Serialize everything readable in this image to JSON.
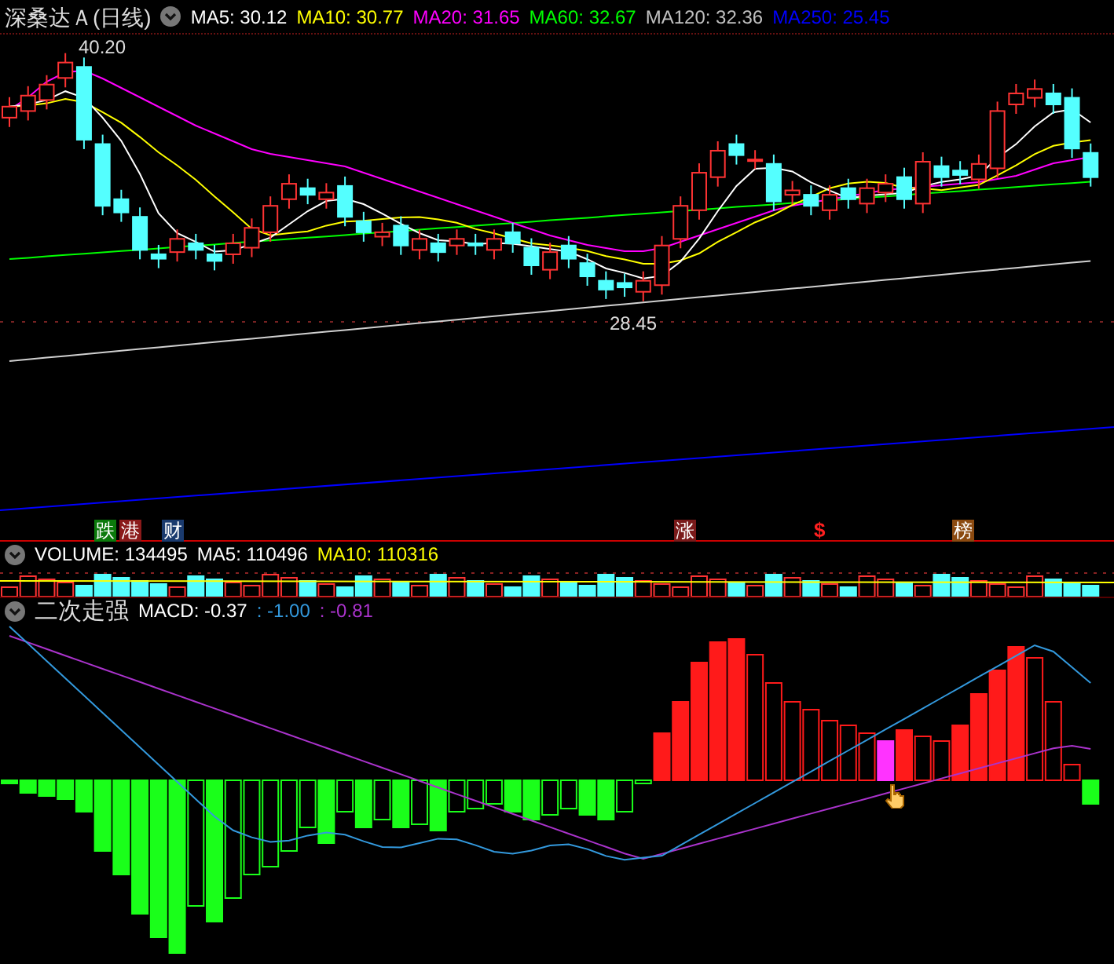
{
  "header": {
    "title": "深桑达Ａ(日线)",
    "indicators": [
      {
        "label": "MA5: 30.12",
        "color": "#ffffff"
      },
      {
        "label": "MA10: 30.77",
        "color": "#ffff00"
      },
      {
        "label": "MA20: 31.65",
        "color": "#ff00ff"
      },
      {
        "label": "MA60: 32.67",
        "color": "#00ff00"
      },
      {
        "label": "MA120: 32.36",
        "color": "#c0c0c0"
      },
      {
        "label": "MA250: 25.45",
        "color": "#0000ff"
      }
    ]
  },
  "price_marks": {
    "high": "40.20",
    "low": "28.45"
  },
  "events": [
    {
      "label": "跌",
      "kind": "badge",
      "color": "#0b7a0b"
    },
    {
      "label": "港",
      "kind": "badge",
      "color": "#8b1a1a"
    },
    {
      "label": "财",
      "kind": "badge",
      "color": "#1a3a6e"
    },
    {
      "label": "涨",
      "kind": "badge",
      "color": "#7a1a1a"
    },
    {
      "label": "$",
      "kind": "mark",
      "color": "#ff2020"
    },
    {
      "label": "榜",
      "kind": "badge",
      "color": "#8b4a10"
    }
  ],
  "volume": {
    "items": [
      {
        "label": "VOLUME: 134495",
        "color": "#ffffff"
      },
      {
        "label": "MA5: 110496",
        "color": "#ffffff"
      },
      {
        "label": "MA10: 110316",
        "color": "#ffff00"
      }
    ]
  },
  "macd": {
    "name": "二次走强",
    "items": [
      {
        "label": "MACD: -0.37",
        "color": "#ffffff"
      },
      {
        "label": ": -1.00",
        "color": "#3399dd"
      },
      {
        "label": ": -0.81",
        "color": "#aa33cc"
      }
    ]
  }
}
